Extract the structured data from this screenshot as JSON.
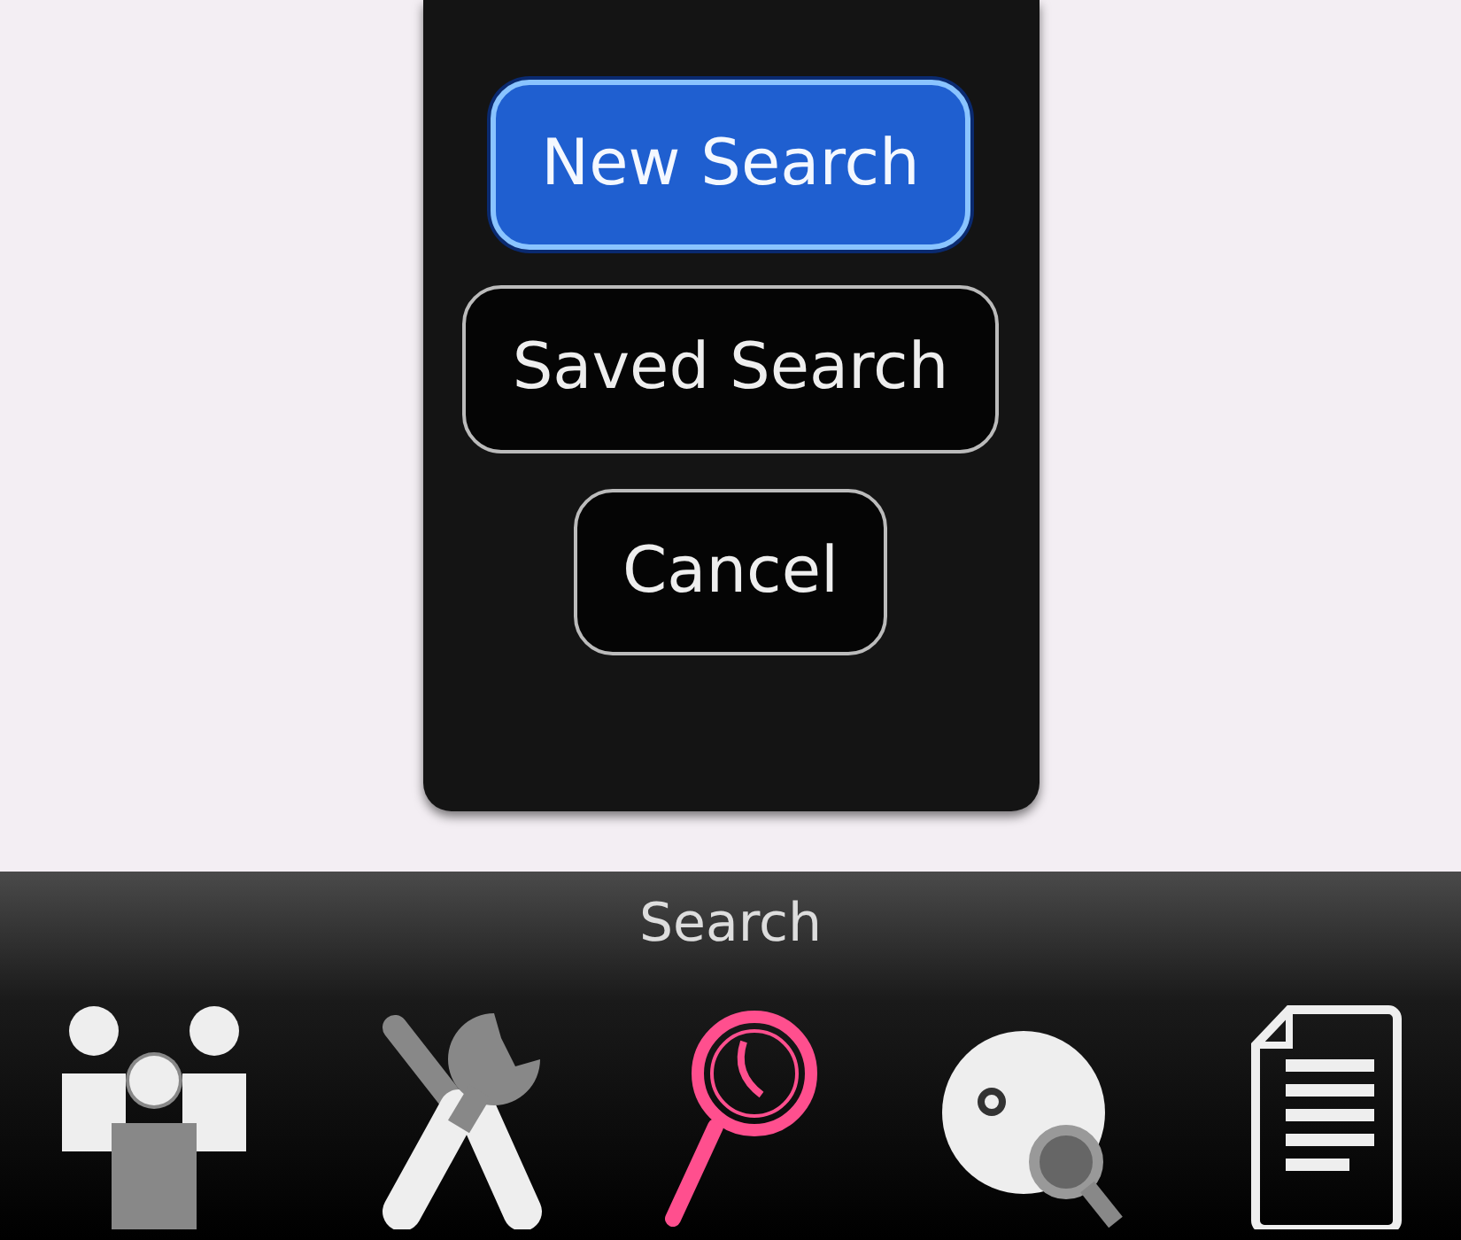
{
  "dialog": {
    "buttons": [
      {
        "label": "New Search",
        "selected": true
      },
      {
        "label": "Saved Search",
        "selected": false
      },
      {
        "label": "Cancel",
        "selected": false
      }
    ]
  },
  "toolbar": {
    "caption": "Search",
    "items": [
      {
        "kind": "people",
        "selected": false
      },
      {
        "kind": "tools",
        "selected": false
      },
      {
        "kind": "search",
        "selected": true
      },
      {
        "kind": "disc",
        "selected": false
      },
      {
        "kind": "document",
        "selected": false
      }
    ]
  }
}
